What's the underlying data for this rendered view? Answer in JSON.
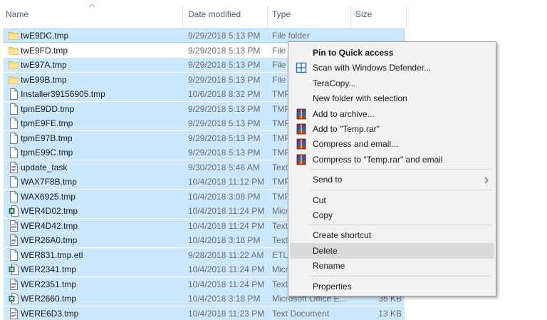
{
  "columns": {
    "name": "Name",
    "date": "Date modified",
    "type": "Type",
    "size": "Size"
  },
  "files": [
    {
      "name": "twE9DC.tmp",
      "date": "9/29/2018 5:13 PM",
      "type": "File folder",
      "size": "",
      "icon": "folder-icon",
      "selected": true,
      "focus": true
    },
    {
      "name": "twE9FD.tmp",
      "date": "9/29/2018 5:13 PM",
      "type": "File f",
      "size": "",
      "icon": "folder-icon",
      "selected": false
    },
    {
      "name": "twE97A.tmp",
      "date": "9/29/2018 5:13 PM",
      "type": "File f",
      "size": "",
      "icon": "folder-icon",
      "selected": true
    },
    {
      "name": "twE99B.tmp",
      "date": "9/29/2018 5:13 PM",
      "type": "File f",
      "size": "",
      "icon": "folder-icon",
      "selected": true
    },
    {
      "name": "Installer39156905.tmp",
      "date": "10/6/2018 8:32 PM",
      "type": "TMP",
      "size": "",
      "icon": "file-icon",
      "selected": true
    },
    {
      "name": "tpmE9DD.tmp",
      "date": "9/29/2018 5:13 PM",
      "type": "TMP",
      "size": "",
      "icon": "file-icon",
      "selected": true
    },
    {
      "name": "tpmE9FE.tmp",
      "date": "9/29/2018 5:13 PM",
      "type": "TMP",
      "size": "",
      "icon": "file-icon",
      "selected": true
    },
    {
      "name": "tpmE97B.tmp",
      "date": "9/29/2018 5:13 PM",
      "type": "TMP",
      "size": "",
      "icon": "file-icon",
      "selected": true
    },
    {
      "name": "tpmE99C.tmp",
      "date": "9/29/2018 5:13 PM",
      "type": "TMP",
      "size": "",
      "icon": "file-icon",
      "selected": true
    },
    {
      "name": "update_task",
      "date": "9/30/2018 5:46 AM",
      "type": "Text",
      "size": "",
      "icon": "text-file-icon",
      "selected": true
    },
    {
      "name": "WAX7F8B.tmp",
      "date": "10/4/2018 11:12 PM",
      "type": "TMP",
      "size": "",
      "icon": "file-icon",
      "selected": true
    },
    {
      "name": "WAX6925.tmp",
      "date": "10/4/2018 3:08 PM",
      "type": "TMP",
      "size": "",
      "icon": "file-icon",
      "selected": true
    },
    {
      "name": "WER4D02.tmp",
      "date": "10/4/2018 11:24 PM",
      "type": "Micr",
      "size": "",
      "icon": "excel-file-icon",
      "selected": true
    },
    {
      "name": "WER4D42.tmp",
      "date": "10/4/2018 11:24 PM",
      "type": "Text",
      "size": "",
      "icon": "text-file-icon",
      "selected": true
    },
    {
      "name": "WER26A0.tmp",
      "date": "10/4/2018 3:18 PM",
      "type": "Text",
      "size": "",
      "icon": "text-file-icon",
      "selected": true
    },
    {
      "name": "WER831.tmp.etl",
      "date": "9/28/2018 11:22 AM",
      "type": "ETL",
      "size": "",
      "icon": "file-icon",
      "selected": true
    },
    {
      "name": "WER2341.tmp",
      "date": "10/4/2018 11:24 PM",
      "type": "Micr",
      "size": "",
      "icon": "excel-file-icon",
      "selected": true
    },
    {
      "name": "WER2351.tmp",
      "date": "10/4/2018 11:24 PM",
      "type": "Text",
      "size": "",
      "icon": "text-file-icon",
      "selected": true
    },
    {
      "name": "WER2660.tmp",
      "date": "10/4/2018 3:18 PM",
      "type": "Microsoft Office E...",
      "size": "36 KB",
      "icon": "excel-file-icon",
      "selected": true
    },
    {
      "name": "WERE6D3.tmp",
      "date": "10/4/2018 11:23 PM",
      "type": "Text Document",
      "size": "13 KB",
      "icon": "text-file-icon",
      "selected": true
    }
  ],
  "context_menu": {
    "items": [
      {
        "kind": "item",
        "label": "Pin to Quick access",
        "bold": true,
        "icon": ""
      },
      {
        "kind": "item",
        "label": "Scan with Windows Defender...",
        "icon": "defender-shield-icon"
      },
      {
        "kind": "item",
        "label": "TeraCopy...",
        "icon": ""
      },
      {
        "kind": "item",
        "label": "New folder with selection",
        "icon": ""
      },
      {
        "kind": "item",
        "label": "Add to archive...",
        "icon": "winrar-icon"
      },
      {
        "kind": "item",
        "label": "Add to \"Temp.rar\"",
        "icon": "winrar-icon"
      },
      {
        "kind": "item",
        "label": "Compress and email...",
        "icon": "winrar-icon"
      },
      {
        "kind": "item",
        "label": "Compress to \"Temp.rar\" and email",
        "icon": "winrar-icon"
      },
      {
        "kind": "separator"
      },
      {
        "kind": "item",
        "label": "Send to",
        "icon": "",
        "submenu": true
      },
      {
        "kind": "separator"
      },
      {
        "kind": "item",
        "label": "Cut",
        "icon": ""
      },
      {
        "kind": "item",
        "label": "Copy",
        "icon": ""
      },
      {
        "kind": "separator"
      },
      {
        "kind": "item",
        "label": "Create shortcut",
        "icon": ""
      },
      {
        "kind": "item",
        "label": "Delete",
        "icon": "",
        "hover": true
      },
      {
        "kind": "item",
        "label": "Rename",
        "icon": ""
      },
      {
        "kind": "separator"
      },
      {
        "kind": "item",
        "label": "Properties",
        "icon": ""
      }
    ]
  },
  "colors": {
    "selection": "#cce8ff",
    "folder": "#f8d775",
    "menu_bg": "#f2f2f2",
    "menu_hover": "#dadada"
  }
}
